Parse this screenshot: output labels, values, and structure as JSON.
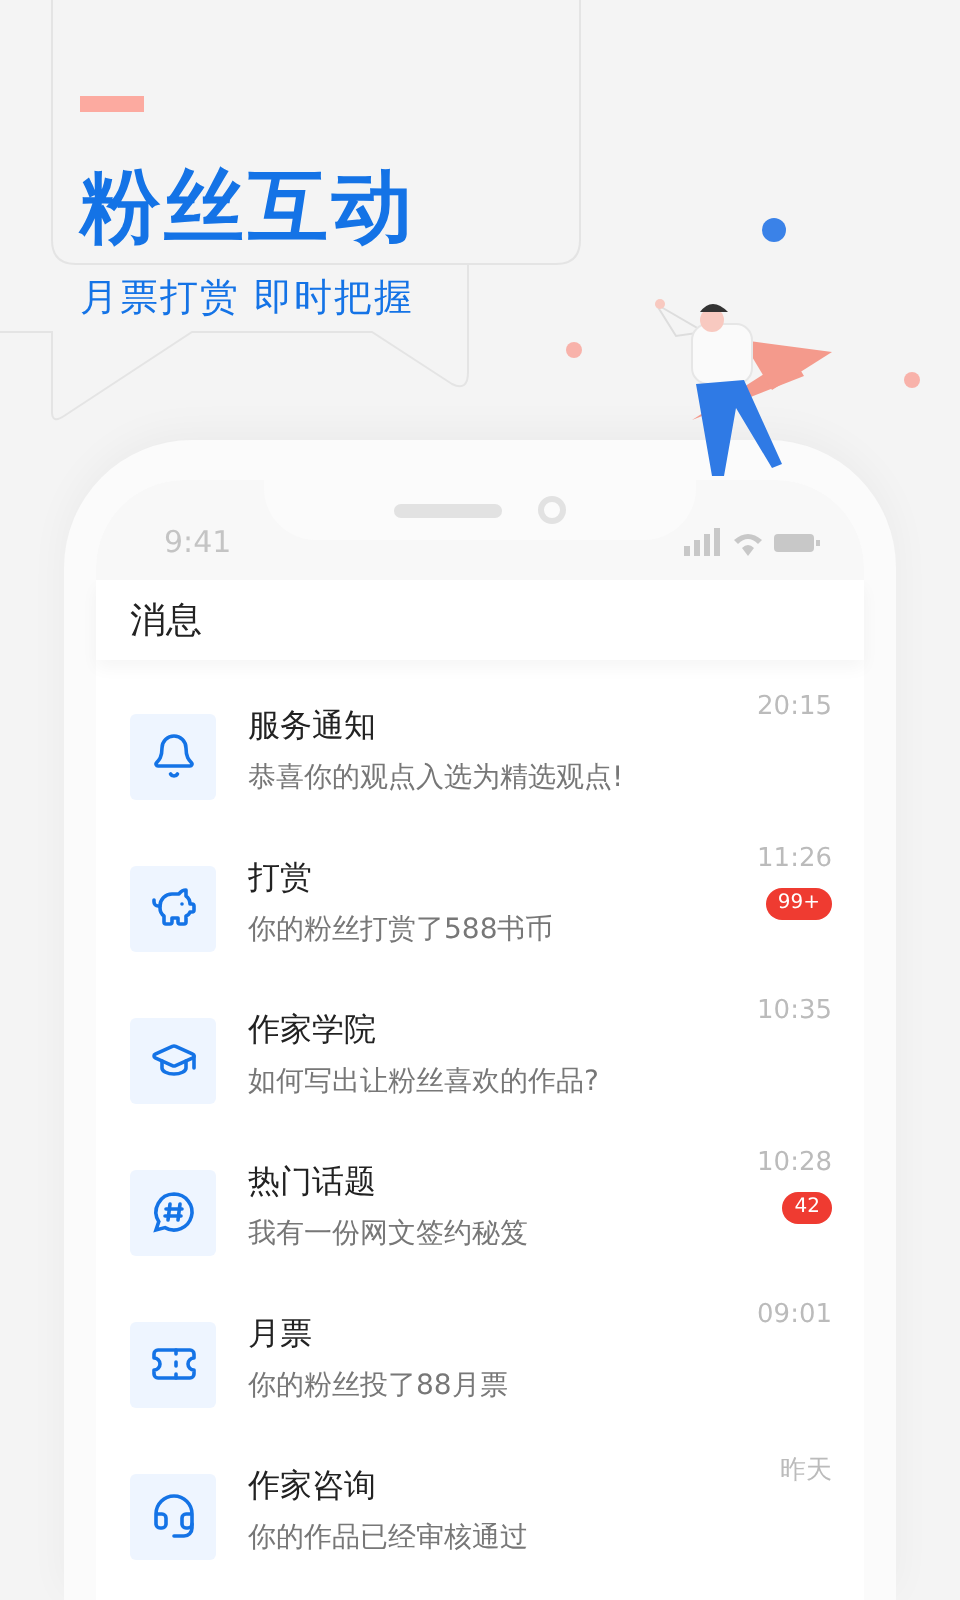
{
  "hero": {
    "title": "粉丝互动",
    "subtitle": "月票打赏 即时把握"
  },
  "status_bar": {
    "time": "9:41"
  },
  "header": {
    "title": "消息"
  },
  "messages": [
    {
      "kind": "bell",
      "title": "服务通知",
      "preview": "恭喜你的观点入选为精选观点!",
      "time": "20:15"
    },
    {
      "kind": "piggy",
      "title": "打赏",
      "preview": "你的粉丝打赏了588书币",
      "time": "11:26",
      "badge": "99+"
    },
    {
      "kind": "cap",
      "title": "作家学院",
      "preview": "如何写出让粉丝喜欢的作品?",
      "time": "10:35"
    },
    {
      "kind": "topic",
      "title": "热门话题",
      "preview": "我有一份网文签约秘笈",
      "time": "10:28",
      "badge": "42"
    },
    {
      "kind": "ticket",
      "title": "月票",
      "preview": "你的粉丝投了88月票",
      "time": "09:01"
    },
    {
      "kind": "headset",
      "title": "作家咨询",
      "preview": "你的作品已经审核通过",
      "time": "昨天"
    }
  ]
}
